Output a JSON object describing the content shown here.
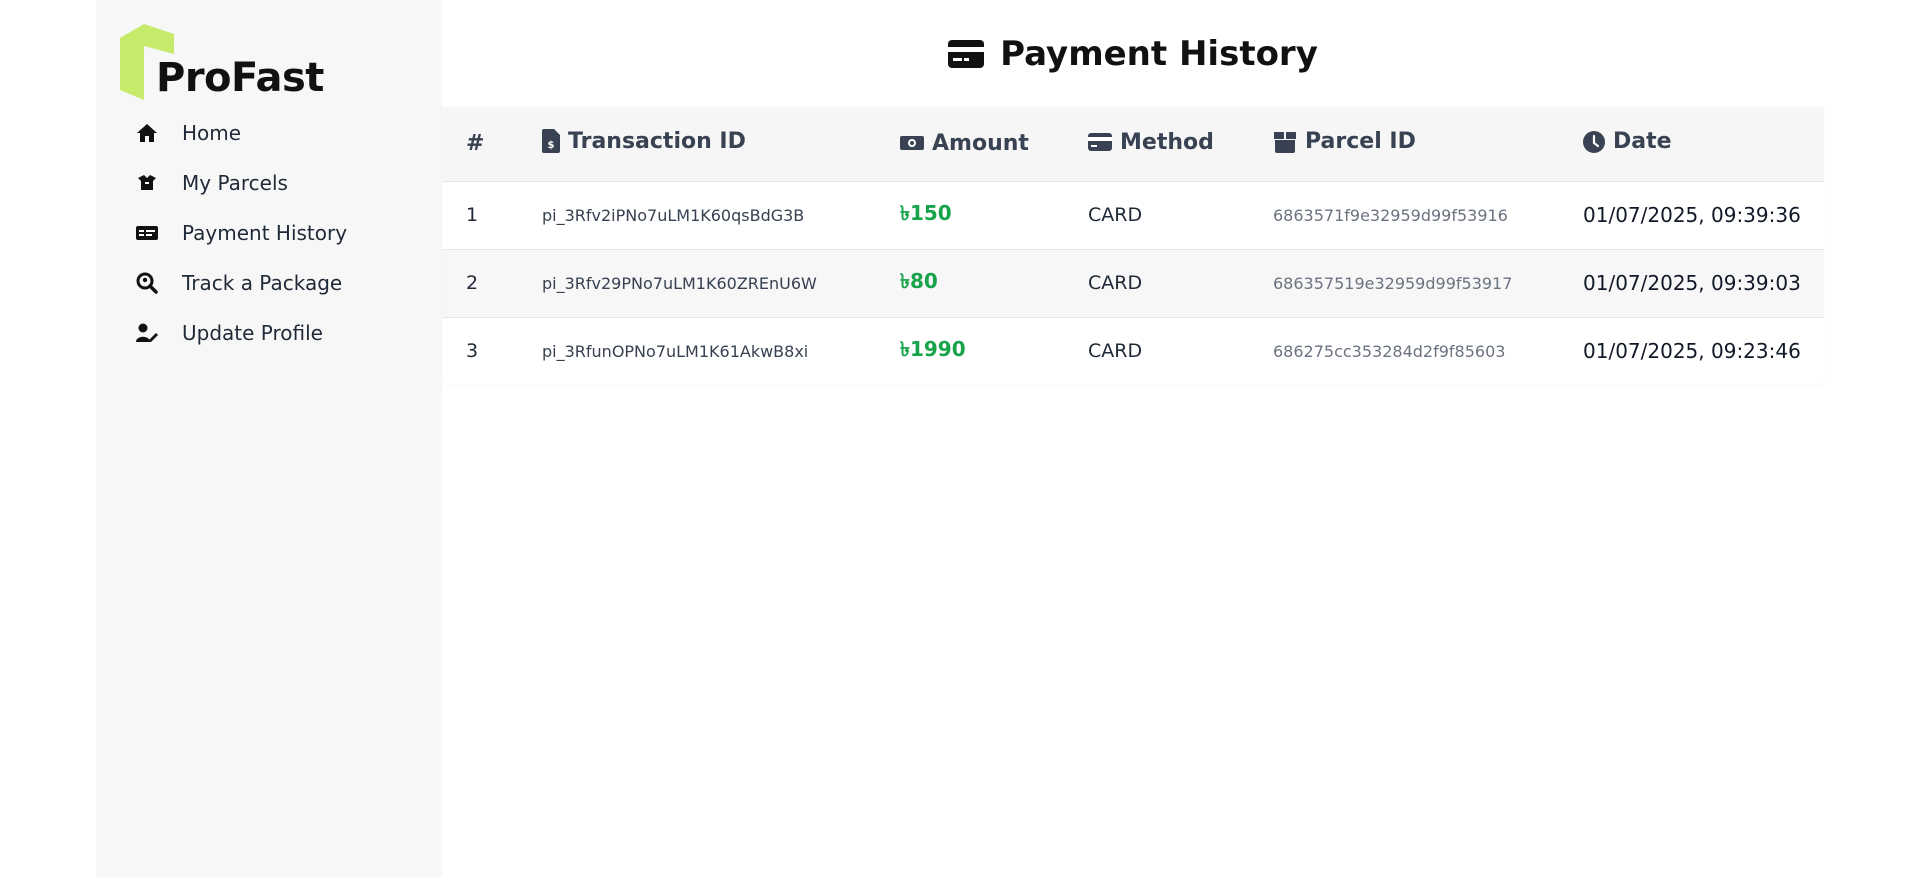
{
  "brand": {
    "name": "ProFast",
    "accent": "#c6ea6a"
  },
  "sidebar": {
    "items": [
      {
        "label": "Home",
        "icon": "home-icon"
      },
      {
        "label": "My Parcels",
        "icon": "box-open-icon"
      },
      {
        "label": "Payment History",
        "icon": "money-check-icon"
      },
      {
        "label": "Track a Package",
        "icon": "search-location-icon"
      },
      {
        "label": "Update Profile",
        "icon": "user-edit-icon"
      }
    ]
  },
  "page": {
    "title": "Payment History",
    "title_icon": "credit-card-icon"
  },
  "table": {
    "headers": [
      {
        "label": "#",
        "icon": ""
      },
      {
        "label": "Transaction ID",
        "icon": "file-invoice-dollar-icon"
      },
      {
        "label": "Amount",
        "icon": "money-bill-icon"
      },
      {
        "label": "Method",
        "icon": "credit-card-icon"
      },
      {
        "label": "Parcel ID",
        "icon": "box-icon"
      },
      {
        "label": "Date",
        "icon": "clock-icon"
      }
    ],
    "rows": [
      {
        "num": "1",
        "txn": "pi_3Rfv2iPNo7uLM1K60qsBdG3B",
        "amount": "৳150",
        "method": "CARD",
        "parcel": "6863571f9e32959d99f53916",
        "date": "01/07/2025, 09:39:36"
      },
      {
        "num": "2",
        "txn": "pi_3Rfv29PNo7uLM1K60ZREnU6W",
        "amount": "৳80",
        "method": "CARD",
        "parcel": "686357519e32959d99f53917",
        "date": "01/07/2025, 09:39:03"
      },
      {
        "num": "3",
        "txn": "pi_3RfunOPNo7uLM1K61AkwB8xi",
        "amount": "৳1990",
        "method": "CARD",
        "parcel": "686275cc353284d2f9f85603",
        "date": "01/07/2025, 09:23:46"
      }
    ]
  },
  "colors": {
    "amount": "#16a34a",
    "sidebar_bg": "#f7f7f7",
    "header_bg": "#f6f6f6"
  }
}
